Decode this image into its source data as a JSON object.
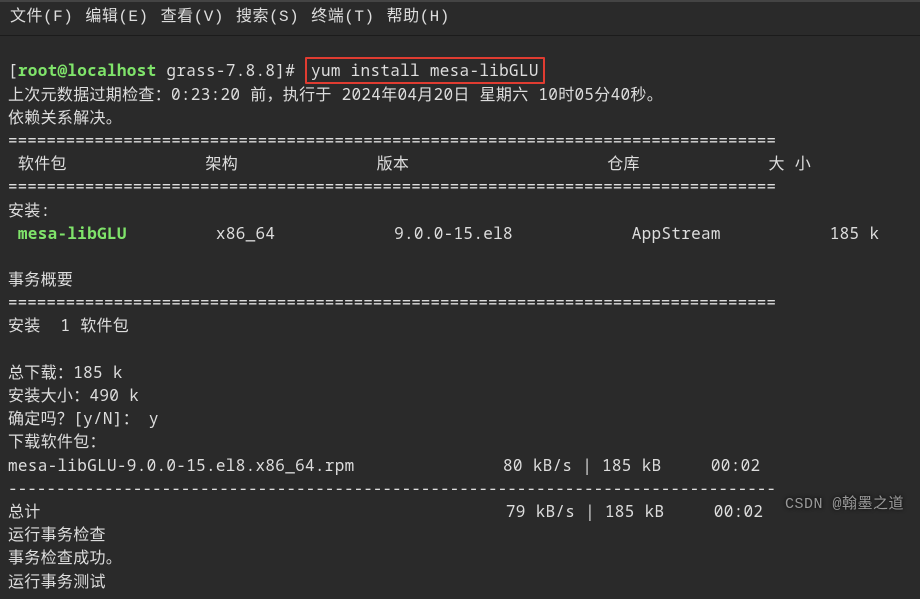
{
  "menu": {
    "file": "文件(F)",
    "edit": "编辑(E)",
    "view": "查看(V)",
    "search": "搜索(S)",
    "terminal": "终端(T)",
    "help": "帮助(H)"
  },
  "prompt": {
    "open": "[",
    "user_host": "root@localhost",
    "cwd": "grass-7.8.8",
    "close": "]#",
    "command": "yum install mesa-libGLU"
  },
  "out": {
    "meta": "上次元数据过期检查：0:23:20 前，执行于 2024年04月20日 星期六 10时05分40秒。",
    "resolved": "依赖关系解决。",
    "table_header": " 软件包              架构              版本                    仓库             大 小",
    "installing": "安装:",
    "pkg_name": "mesa-libGLU",
    "pkg_row_rest": "         x86_64            9.0.0-15.el8            AppStream           185 k",
    "tx_summary": "事务概要",
    "install_count": "安装  1 软件包",
    "total_dl": "总下载：185 k",
    "inst_size": "安装大小：490 k",
    "confirm": "确定吗？[y/N]： y",
    "dl_pkg": "下载软件包：",
    "rpm_line": "mesa-libGLU-9.0.0-15.el8.x86_64.rpm               80 kB/s | 185 kB     00:02",
    "total_line": "总计                                               79 kB/s | 185 kB     00:02",
    "run_check": "运行事务检查",
    "check_ok": "事务检查成功。",
    "run_test": "运行事务测试"
  },
  "rules": {
    "eq": "================================================================================",
    "dash": "--------------------------------------------------------------------------------"
  },
  "watermark": "CSDN @翰墨之道"
}
